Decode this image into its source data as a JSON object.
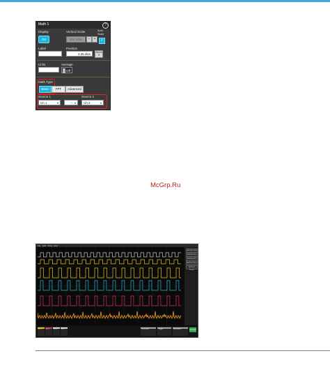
{
  "panel": {
    "title": "Math 1",
    "help": "?",
    "display_label": "Display",
    "display_value": "On",
    "vertical_scale_label": "Vertical Scale",
    "vertical_scale_value": "200 V/div",
    "auto_scale_label": "Auto Scale",
    "stepper_down": "–",
    "stepper_up": "+",
    "auto_scale_checked": "✓",
    "label_label": "Label",
    "position_label": "Position",
    "position_value": "2.26 divs",
    "set_to_zero": "Set to 0",
    "units_label": "Units",
    "average_label": "Average",
    "average_value": "Off",
    "math_type_label": "Math Type",
    "math_types": [
      "Basic",
      "FFT",
      "Advanced"
    ],
    "selected_math_type": "Basic",
    "source1_label": "Source 1",
    "source1_value": "Ch 1",
    "operator_value": "–",
    "source2_label": "Source 2",
    "source2_value": "Ch 2"
  },
  "watermark": "McGrp.Ru",
  "scope": {
    "menu": [
      "File",
      "Edit",
      "Utility",
      "Help"
    ],
    "right_buttons": [
      "Add New Math",
      "Add New Bus",
      "Add New Ref",
      "Add New Meas",
      "Add New Search"
    ],
    "bottom_badges": [
      {
        "name": "Ch 1",
        "color": "#e6c21a"
      },
      {
        "name": "Ch 2",
        "color": "#2bb8d6"
      },
      {
        "name": "Ch 3",
        "color": "#d8325a"
      },
      {
        "name": "Ch 4",
        "color": "#f0a020"
      }
    ],
    "right_badges": [
      "Horizontal",
      "Trigger",
      "Acquisition"
    ],
    "add_new": "Add New",
    "colors": {
      "ch1": "#e6c21a",
      "ch2": "#2bb8d6",
      "ch3": "#d8325a",
      "ch4": "#f0a020",
      "ch5": "#c8c8c8"
    }
  }
}
